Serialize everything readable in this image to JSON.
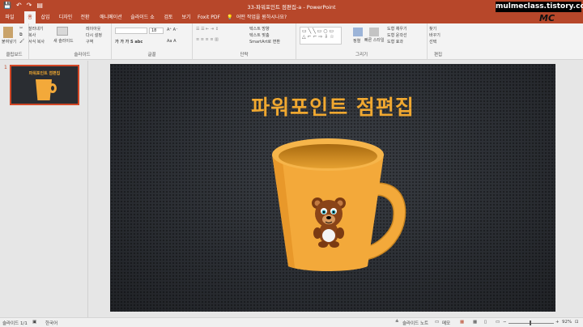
{
  "titlebar": {
    "title": "33-파워포인트 점편집-a  -  PowerPoint",
    "qat": [
      "💾",
      "↶",
      "↷",
      "▤"
    ]
  },
  "watermark": {
    "url": "mulmeclass.tistory.com",
    "logo": "MC"
  },
  "tabs": [
    "파일",
    "홈",
    "삽입",
    "디자인",
    "전환",
    "애니메이션",
    "슬라이드 쇼",
    "검토",
    "보기",
    "Foxit PDF",
    "어떤 작업을 원하시나요?"
  ],
  "ribbon": {
    "clipboard": {
      "paste": "붙여넣기",
      "cut": "잘라내기",
      "copy": "복사",
      "format_painter": "서식 복사",
      "label": "클립보드"
    },
    "slides": {
      "new_slide": "새 슬라이드",
      "layout": "레이아웃",
      "reset": "다시 설정",
      "section": "구역",
      "label": "슬라이드"
    },
    "font": {
      "size": "18",
      "label": "글꼴"
    },
    "paragraph": {
      "text_direction": "텍스트 방향",
      "align_text": "텍스트 맞춤",
      "smartart": "SmartArt로 변환",
      "label": "단락"
    },
    "drawing": {
      "arrange": "정렬",
      "quick_styles": "빠른 스타일",
      "fill": "도형 채우기",
      "outline": "도형 윤곽선",
      "effects": "도형 효과",
      "label": "그리기"
    },
    "editing": {
      "find": "찾기",
      "replace": "바꾸기",
      "select": "선택",
      "label": "편집"
    }
  },
  "thumbnail": {
    "number": "1",
    "title": "파워포인트 점편집"
  },
  "slide": {
    "title": "파워포인트 점편집",
    "colors": {
      "title": "#f0a830",
      "cup": "#f3a93a",
      "background": "#2a2d32"
    }
  },
  "status": {
    "slide": "슬라이드 1/1",
    "language": "한국어",
    "notes": "슬라이드 노트",
    "comments": "메모",
    "zoom": "92%"
  }
}
